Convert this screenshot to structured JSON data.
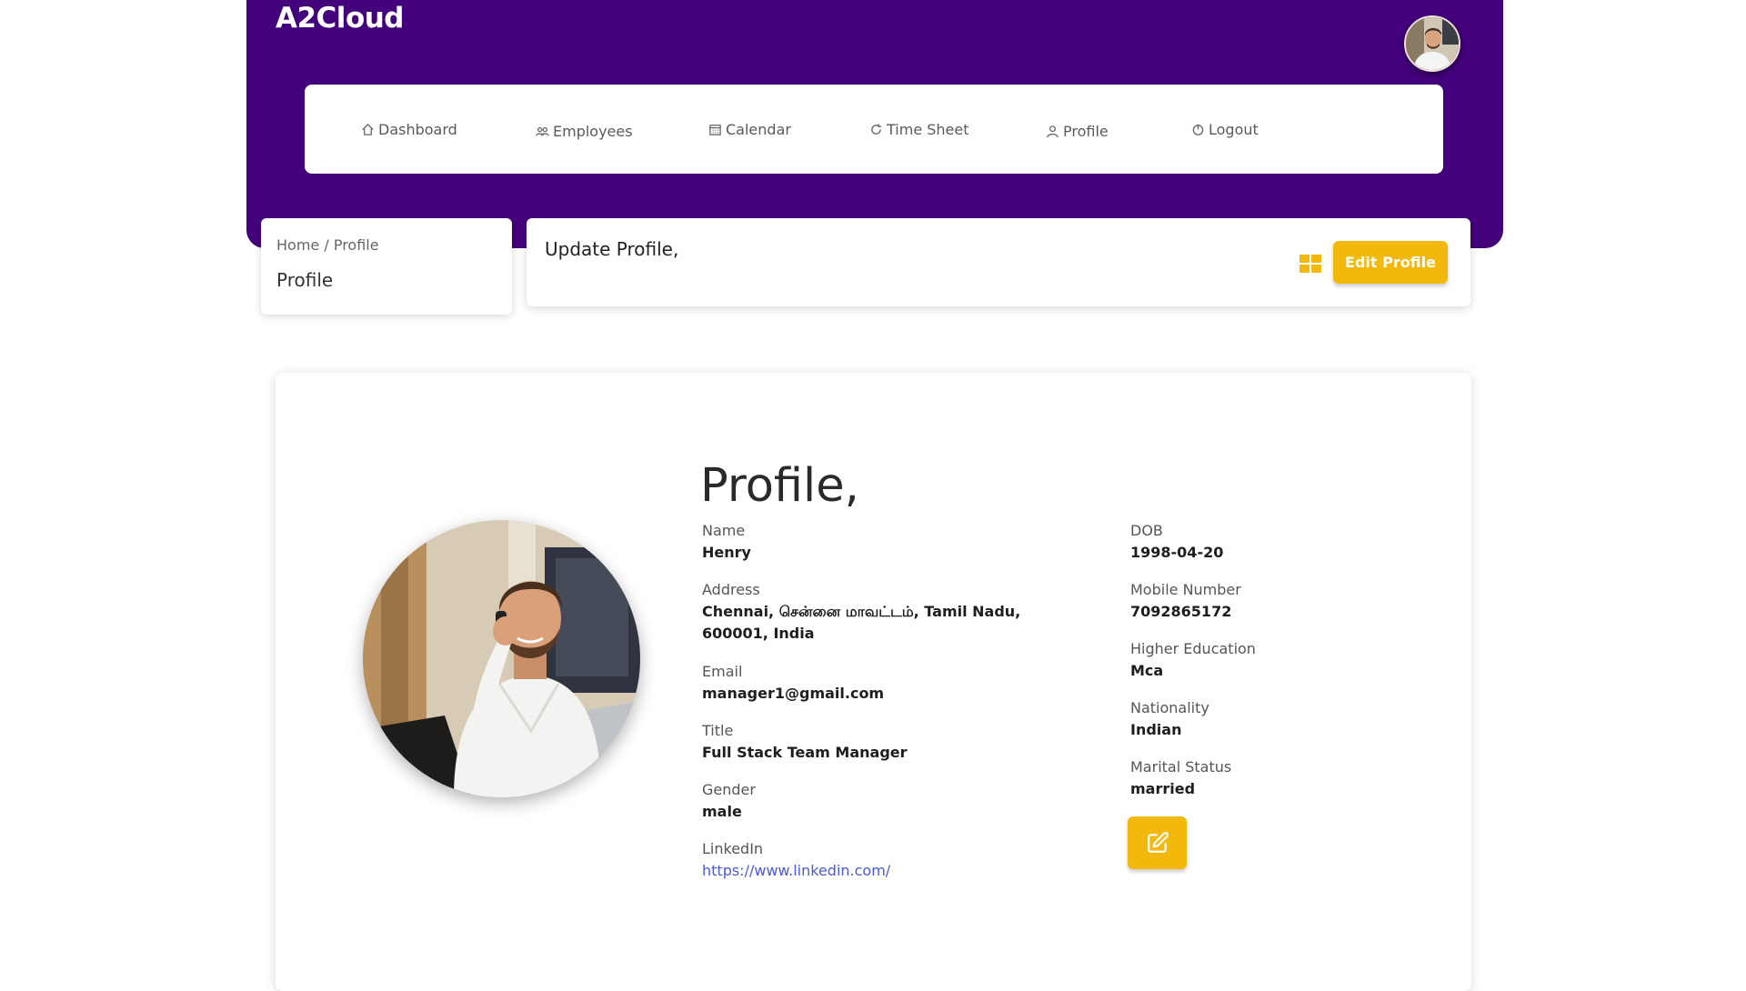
{
  "app": {
    "brand": "A2Cloud"
  },
  "nav": {
    "items": [
      {
        "label": "Dashboard",
        "icon": "home-icon"
      },
      {
        "label": "Employees",
        "icon": "users-icon"
      },
      {
        "label": "Calendar",
        "icon": "calendar-icon"
      },
      {
        "label": "Time Sheet",
        "icon": "refresh-icon"
      },
      {
        "label": "Profile",
        "icon": "user-icon"
      },
      {
        "label": "Logout",
        "icon": "power-icon"
      }
    ]
  },
  "breadcrumb": {
    "home": "Home",
    "separator": "/",
    "current": "Profile",
    "title": "Profile"
  },
  "update": {
    "title": "Update Profile,",
    "grid_icon": "grid-icon",
    "edit_button": "Edit Profile"
  },
  "profile": {
    "heading": "Profile,",
    "left": [
      {
        "label": "Name",
        "value": "Henry"
      },
      {
        "label": "Address",
        "value": "Chennai, சென்னை மாவட்டம், Tamil Nadu, 600001, India"
      },
      {
        "label": "Email",
        "value": "manager1@gmail.com"
      },
      {
        "label": "Title",
        "value": "Full Stack Team Manager"
      },
      {
        "label": "Gender",
        "value": "male"
      },
      {
        "label": "LinkedIn",
        "value": "https://www.linkedin.com/"
      }
    ],
    "right": [
      {
        "label": "DOB",
        "value": "1998-04-20"
      },
      {
        "label": "Mobile Number",
        "value": "7092865172"
      },
      {
        "label": "Higher Education",
        "value": "Mca"
      },
      {
        "label": "Nationality",
        "value": "Indian"
      },
      {
        "label": "Marital Status",
        "value": "married"
      }
    ],
    "edit_icon": "edit-icon"
  },
  "colors": {
    "header_bg": "#44017c",
    "accent": "#f2b90c",
    "link": "#4b59d6"
  }
}
